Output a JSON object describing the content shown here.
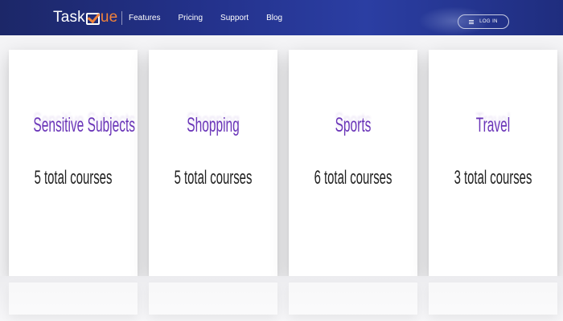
{
  "header": {
    "logo_text_main": "Task",
    "logo_text_accent": "ue",
    "nav": [
      "Features",
      "Pricing",
      "Support",
      "Blog"
    ],
    "login_label": "LOG IN"
  },
  "categories": [
    {
      "title": "Sensitive Subjects",
      "count": "5 total courses"
    },
    {
      "title": "Shopping",
      "count": "5 total courses"
    },
    {
      "title": "Sports",
      "count": "6 total courses"
    },
    {
      "title": "Travel",
      "count": "3 total courses"
    }
  ],
  "colors": {
    "nav_background": "#23318a",
    "logo_accent": "#f0813a",
    "category_title": "#6a35b8",
    "course_count": "#222222"
  },
  "icons": {
    "logo": "checkbox-logo-icon",
    "login": "menu-lines-icon"
  }
}
